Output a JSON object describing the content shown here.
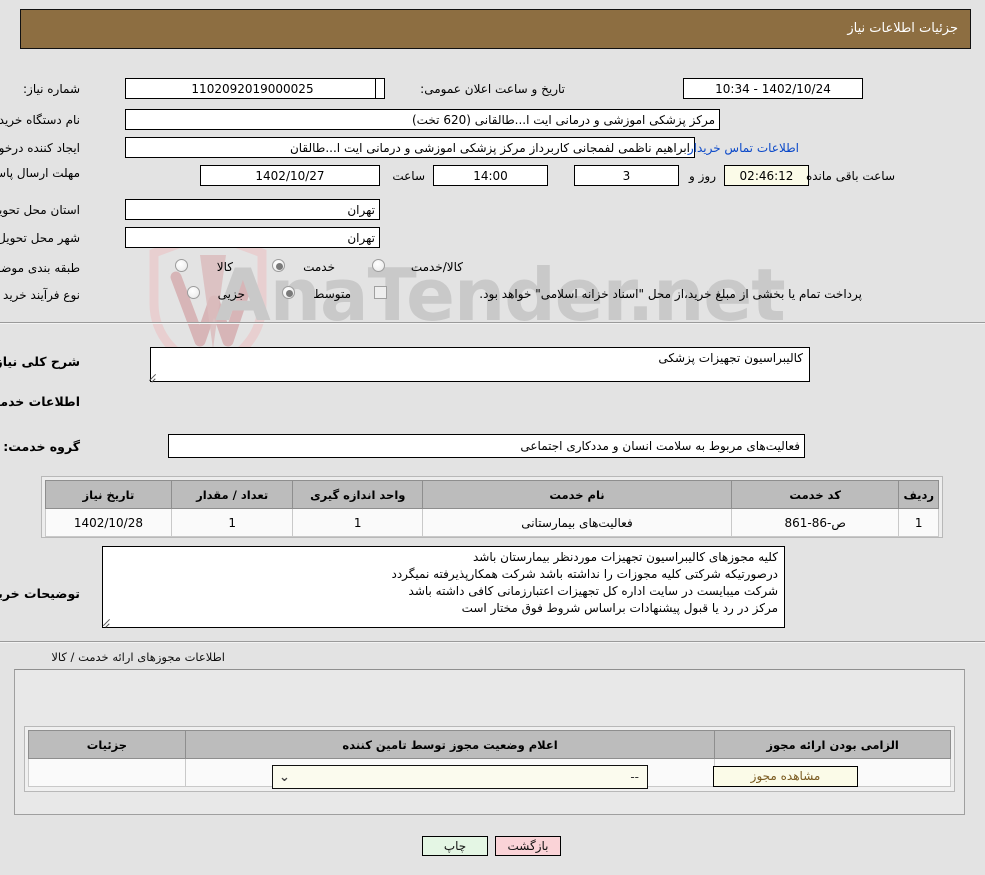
{
  "header": {
    "title": "جزئیات اطلاعات نیاز",
    "bg_color": "#8d6e41",
    "text_color": "#ffffff"
  },
  "watermark": {
    "text": "AnaTender.net"
  },
  "summary": {
    "need_number_label": "شماره نیاز:",
    "need_number_value": "1102092019000025",
    "announce_label": "تاریخ و ساعت اعلان عمومی:",
    "announce_value": "1402/10/24 - 10:34",
    "buyer_org_label": "نام دستگاه خریدار:",
    "buyer_org_value": "مرکز پزشکی  اموزشی و درمانی ایت ا...طالقانی (620 تخت)",
    "creator_label": "ایجاد کننده درخواست:",
    "creator_value": "ابراهیم ناظمی لفمجانی کاربرداز مرکز پزشکی  اموزشی و درمانی ایت ا...طالقان",
    "contact_link": "اطلاعات تماس خریدار",
    "deadline_label": "مهلت ارسال پاسخ: تا تاریخ:",
    "deadline_date": "1402/10/27",
    "time_label": "ساعت",
    "deadline_time": "14:00",
    "days_value": "3",
    "days_label": "روز و",
    "countdown_value": "02:46:12",
    "remaining_label": "ساعت باقی مانده",
    "province_label": "استان محل تحویل:",
    "province_value": "تهران",
    "city_label": "شهر محل تحویل:",
    "city_value": "تهران",
    "category_label": "طبقه بندی موضوعی:",
    "category_options": [
      {
        "label": "کالا",
        "selected": false
      },
      {
        "label": "خدمت",
        "selected": true
      },
      {
        "label": "کالا/خدمت",
        "selected": false
      }
    ],
    "process_label": "نوع فرآیند خرید :",
    "process_options": [
      {
        "label": "جزیی",
        "selected": false
      },
      {
        "label": "متوسط",
        "selected": true
      }
    ],
    "treasury_checkbox_label": "پرداخت تمام یا بخشی از مبلغ خرید،از محل \"اسناد خزانه اسلامی\" خواهد بود.",
    "treasury_checked": false
  },
  "need_description": {
    "label": "شرح کلی نیاز:",
    "value": "کالیبراسیون تجهیزات پزشکی"
  },
  "services_section": {
    "heading": "اطلاعات خدمات مورد نیاز",
    "group_label": "گروه خدمت:",
    "group_value": "فعالیت‌های مربوط به سلامت انسان و مددکاری اجتماعی",
    "table": {
      "headers": [
        "ردیف",
        "کد خدمت",
        "نام خدمت",
        "واحد اندازه گیری",
        "تعداد / مقدار",
        "تاریخ نیاز"
      ],
      "rows": [
        [
          "1",
          "ص-86-861",
          "فعالیت‌های بیمارستانی",
          "1",
          "1",
          "1402/10/28"
        ]
      ]
    }
  },
  "buyer_notes": {
    "label": "توضیحات خریدار:",
    "lines": [
      "کلیه مجوزهای کالیبراسیون تجهیزات موردنظر بیمارستان باشد",
      "درصورتیکه شرکتی کلیه مجوزات را نداشته باشد شرکت همکارپذیرفته نمیگردد",
      "شرکت میبایست در سایت اداره کل تجهیزات اعتبارزمانی کافی داشته باشد",
      "مرکز در رد یا قبول پیشنهادات براساس شروط فوق مختار است"
    ]
  },
  "permits_section": {
    "heading": "اطلاعات مجوزهای ارائه خدمت / کالا",
    "table": {
      "headers": [
        "الزامی بودن ارائه مجوز",
        "اعلام وضعیت مجوز توسط تامین کننده",
        "جزئیات"
      ],
      "row": {
        "required_checked": true,
        "status_value": "--",
        "details_button": "مشاهده مجوز"
      }
    }
  },
  "footer": {
    "print_button": "چاپ",
    "back_button": "بازگشت"
  }
}
